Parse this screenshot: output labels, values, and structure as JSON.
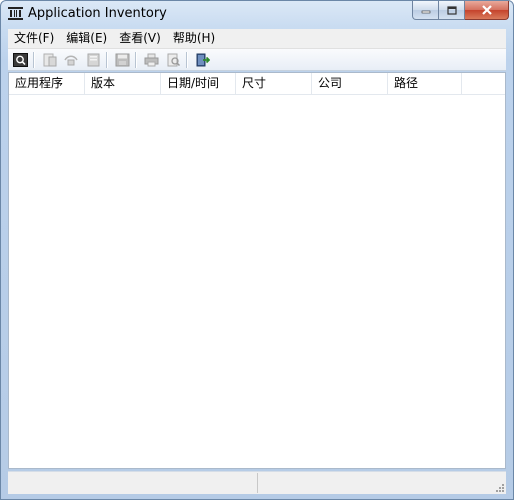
{
  "window": {
    "title": "Application Inventory"
  },
  "menu": [
    "文件(F)",
    "编辑(E)",
    "查看(V)",
    "帮助(H)"
  ],
  "toolbar": {
    "icons": [
      "refresh-icon",
      "properties-icon",
      "copy-icon",
      "html-report-icon",
      "save-icon",
      "print-icon",
      "print-preview-icon",
      "exit-icon"
    ]
  },
  "list": {
    "columns": [
      "应用程序",
      "版本",
      "日期/时间",
      "尺寸",
      "公司",
      "路径"
    ],
    "rows": []
  },
  "status": {
    "panes": [
      "",
      ""
    ]
  },
  "colors": {
    "accent": "#c5432c",
    "frame": "#c9dcf1"
  }
}
